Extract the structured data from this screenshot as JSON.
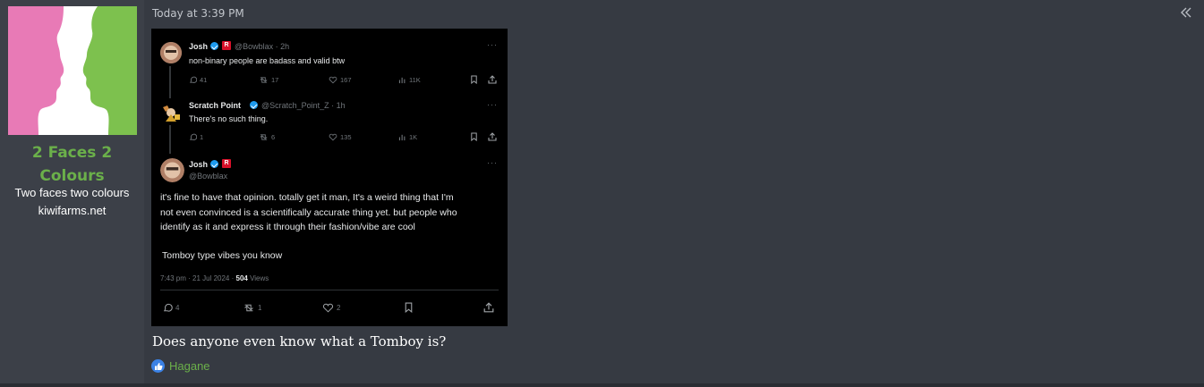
{
  "user": {
    "name": "2 Faces 2 Colours",
    "title_line1": "Two faces two colours",
    "title_line2": "kiwifarms.net",
    "avatar_colors": {
      "left": "#e87ab6",
      "right": "#7dc14e"
    }
  },
  "post": {
    "timestamp": "Today at 3:39 PM",
    "message": "Does anyone even know what a Tomboy is?",
    "reaction": {
      "type": "like-icon",
      "user": "Hagane"
    }
  },
  "embed": {
    "tweet1": {
      "name": "Josh",
      "handle": "@Bowblax · 2h",
      "text": "non-binary people are badass and valid btw",
      "replies": "41",
      "retweets": "17",
      "likes": "167",
      "views": "11K"
    },
    "tweet2": {
      "name": "Scratch Point",
      "handle": "@Scratch_Point_Z · 1h",
      "text": "There's no such thing.",
      "replies": "1",
      "retweets": "6",
      "likes": "135",
      "views": "1K"
    },
    "tweet3": {
      "name": "Josh",
      "handle": "@Bowblax",
      "body_lines": [
        "it's fine to have that opinion. totally get it man, It's a weird thing that I'm",
        "not even convinced is a scientifically accurate thing yet. but people who",
        "identify as it and express it through their fashion/vibe are cool"
      ],
      "body_extra": "Tomboy type vibes you know",
      "meta_date": "7:43 pm · 21 Jul 2024 · ",
      "meta_views": "504",
      "meta_views_label": " Views",
      "replies": "4",
      "retweets": "1",
      "likes": "2"
    },
    "badge_letter": "R",
    "menu_dots": "···"
  }
}
